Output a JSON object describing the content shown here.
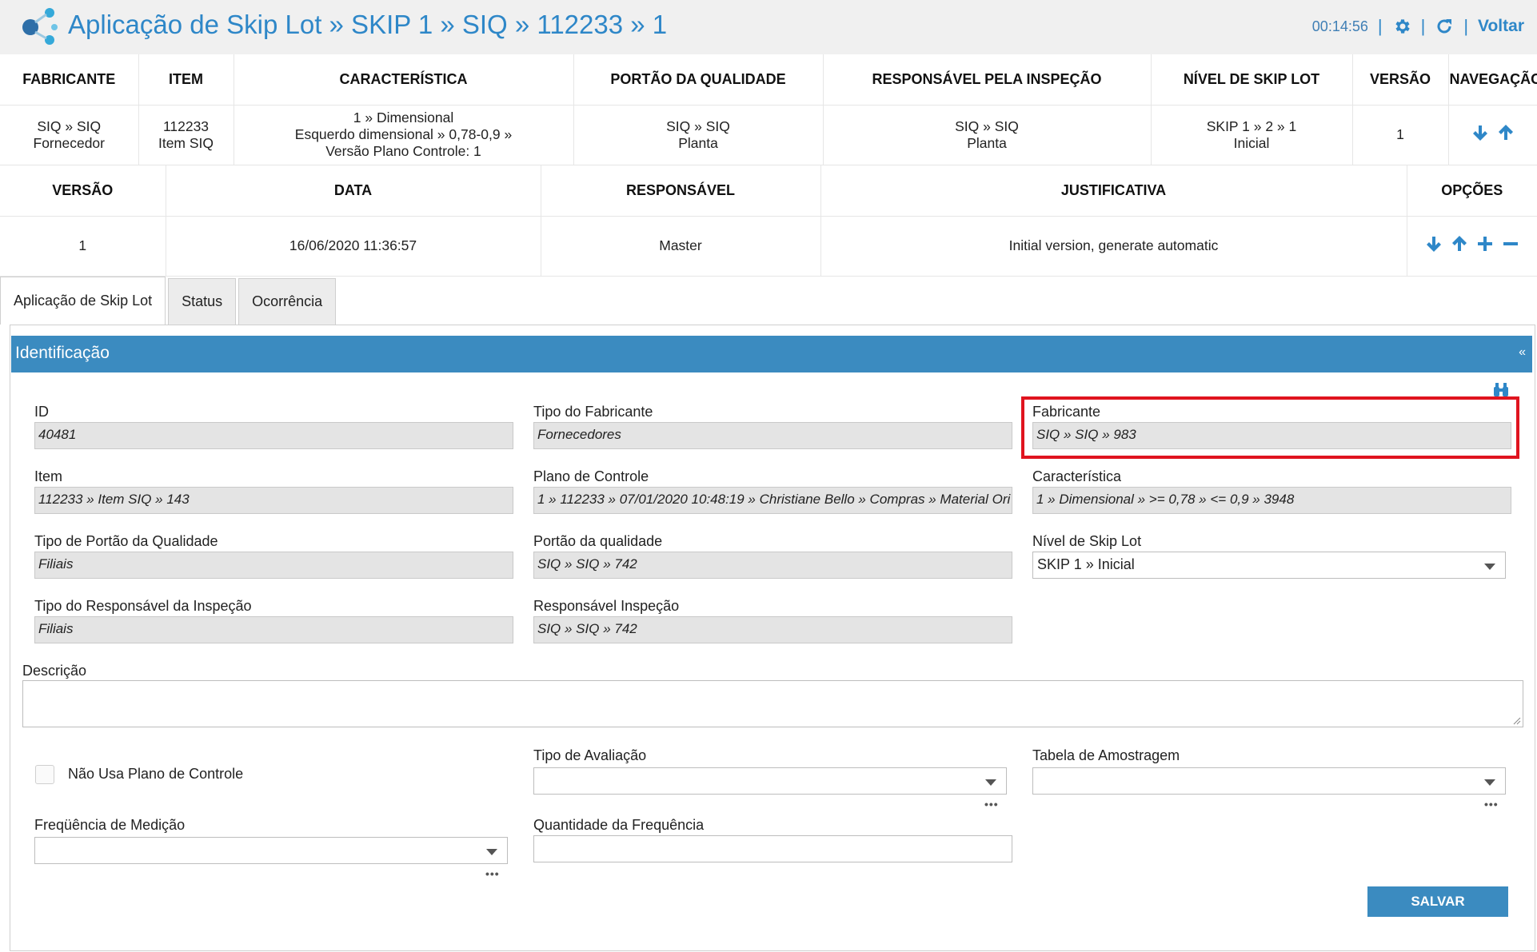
{
  "header": {
    "title": "Aplicação de Skip Lot » SKIP 1 » SIQ » 112233 » 1",
    "timer": "00:14:56",
    "back_label": "Voltar",
    "accent_color": "#2e87c8"
  },
  "table1": {
    "headers": [
      "FABRICANTE",
      "ITEM",
      "CARACTERÍSTICA",
      "PORTÃO DA QUALIDADE",
      "RESPONSÁVEL PELA INSPEÇÃO",
      "NÍVEL DE SKIP LOT",
      "VERSÃO",
      "NAVEGAÇÃO"
    ],
    "row": {
      "fabricante": [
        "SIQ » SIQ",
        "Fornecedor"
      ],
      "item": [
        "112233",
        "Item SIQ"
      ],
      "caracteristica": [
        "1 » Dimensional",
        "Esquerdo dimensional » 0,78-0,9 »",
        "Versão Plano Controle: 1"
      ],
      "portao": [
        "SIQ » SIQ",
        "Planta"
      ],
      "responsavel": [
        "SIQ » SIQ",
        "Planta"
      ],
      "nivel": [
        "SKIP 1 » 2 » 1",
        "Inicial"
      ],
      "versao": "1"
    }
  },
  "table2": {
    "headers": [
      "VERSÃO",
      "DATA",
      "RESPONSÁVEL",
      "JUSTIFICATIVA",
      "OPÇÕES"
    ],
    "row": {
      "versao": "1",
      "data": "16/06/2020 11:36:57",
      "responsavel": "Master",
      "justificativa": "Initial version, generate automatic"
    }
  },
  "tabs": [
    "Aplicação de Skip Lot",
    "Status",
    "Ocorrência"
  ],
  "section": {
    "title": "Identificação",
    "collapse": "«"
  },
  "form": {
    "id_label": "ID",
    "id_value": "40481",
    "tipo_fabricante_label": "Tipo do Fabricante",
    "tipo_fabricante_value": "Fornecedores",
    "fabricante_label": "Fabricante",
    "fabricante_value": "SIQ » SIQ » 983",
    "item_label": "Item",
    "item_value": "112233 » Item SIQ » 143",
    "plano_label": "Plano de Controle",
    "plano_value": "1 » 112233 » 07/01/2020 10:48:19 » Christiane Bello » Compras » Material Ori",
    "caracteristica_label": "Característica",
    "caracteristica_value": "1 » Dimensional » >= 0,78 » <= 0,9 » 3948",
    "tipo_portao_label": "Tipo de Portão da Qualidade",
    "tipo_portao_value": "Filiais",
    "portao_label": "Portão da qualidade",
    "portao_value": "SIQ  »  SIQ  » 742",
    "nivel_label": "Nível de Skip Lot",
    "nivel_value": "SKIP 1 » Inicial",
    "tipo_resp_label": "Tipo do Responsável da Inspeção",
    "tipo_resp_value": "Filiais",
    "resp_label": "Responsável Inspeção",
    "resp_value": "SIQ  »  SIQ  » 742",
    "descricao_label": "Descrição",
    "nao_usa_label": "Não Usa Plano de Controle",
    "tipo_avaliacao_label": "Tipo de Avaliação",
    "tabela_label": "Tabela de Amostragem",
    "frequencia_label": "Freqüência de Medição",
    "quantidade_label": "Quantidade da Frequência",
    "more": "•••"
  },
  "save_label": "SALVAR"
}
